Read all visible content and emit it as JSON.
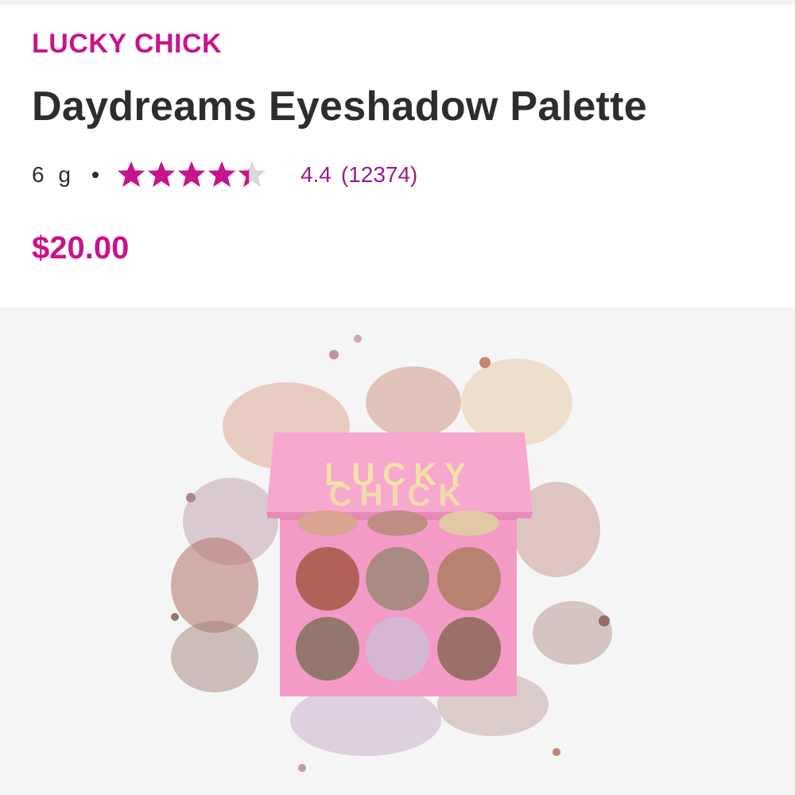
{
  "product": {
    "brand": "LUCKY CHICK",
    "title": "Daydreams Eyeshadow Palette",
    "size": "6 g",
    "rating": "4.4",
    "review_count": "(12374)",
    "rating_value": 4.4,
    "rating_max": 5,
    "price": "$20.00"
  },
  "image": {
    "icon": "eyeshadow-palette-image",
    "palette_text_line1": "LUCKY",
    "palette_text_line2": "CHICK",
    "palette_color": "#f39bc6",
    "shade_colors": [
      "#d9a48f",
      "#bf8e82",
      "#e2c8a4",
      "#b26158",
      "#a98b84",
      "#b88270",
      "#93776c",
      "#d6b7d3",
      "#9a7069"
    ]
  },
  "colors": {
    "brand": "#c8148c",
    "title": "#2d2d2d",
    "rating_text": "#9b1d86",
    "star": "#c8148c",
    "star_empty": "#d9d9d9"
  }
}
